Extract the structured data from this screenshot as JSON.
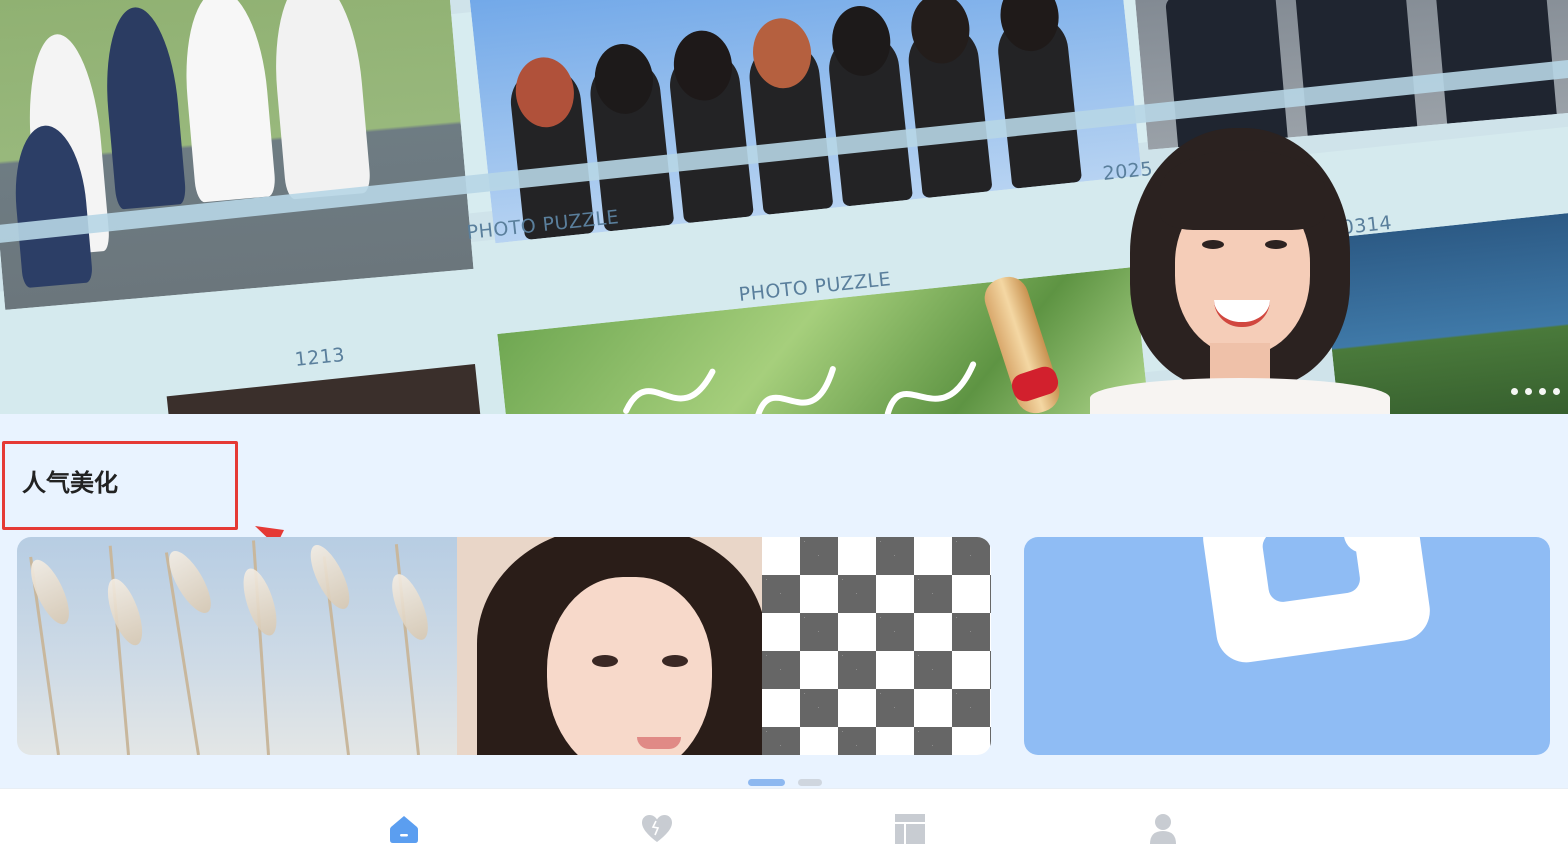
{
  "banner": {
    "captions": [
      "PHOTO PUZZLE",
      "2025",
      "PHOTO PUZZLE",
      "0314",
      "1213"
    ],
    "carousel_dots": 4
  },
  "section": {
    "title": "人气美化"
  },
  "cards_pager": {
    "count": 2,
    "active_index": 0
  },
  "bottom_nav": {
    "items": [
      {
        "icon": "home-icon",
        "active": true
      },
      {
        "icon": "heart-icon",
        "active": false
      },
      {
        "icon": "template-icon",
        "active": false
      },
      {
        "icon": "profile-icon",
        "active": false
      }
    ]
  },
  "colors": {
    "accent": "#5b9ef0",
    "inactive_icon": "#c8ccd2",
    "annotation": "#e53935",
    "page_bg": "#e9f3ff"
  }
}
